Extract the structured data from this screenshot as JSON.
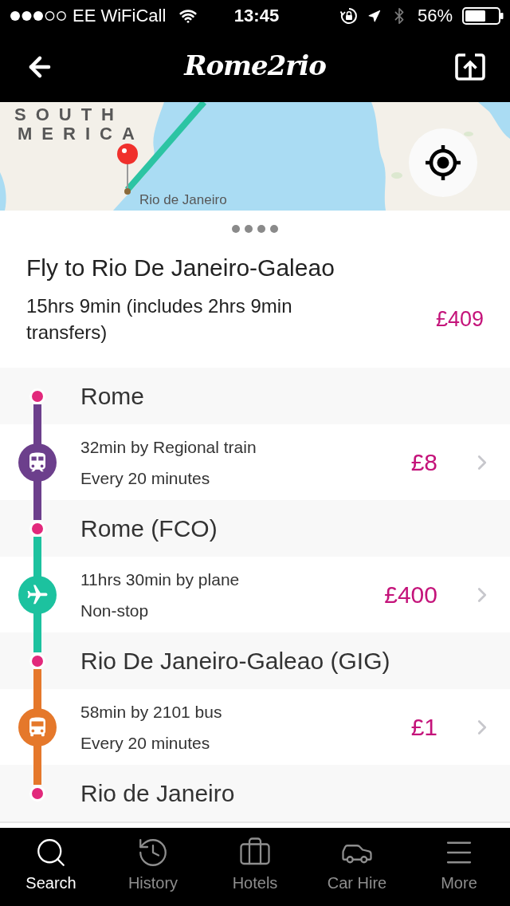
{
  "status_bar": {
    "carrier": "EE WiFiCall",
    "time": "13:45",
    "battery": "56%"
  },
  "header": {
    "logo": "Rome2rio"
  },
  "map": {
    "labels": [
      {
        "kind": "region",
        "text": "SOUTH"
      },
      {
        "kind": "region",
        "text": "MERICA"
      },
      {
        "kind": "city",
        "text": "Rio de Janeiro"
      }
    ]
  },
  "route": {
    "title": "Fly to Rio De Janeiro-Galeao",
    "summary": "15hrs 9min (includes 2hrs 9min transfers)",
    "price": "£409"
  },
  "itinerary": [
    {
      "kind": "stop",
      "name": "Rome"
    },
    {
      "kind": "train",
      "color": "#6c3f8c",
      "description": "32min by Regional train",
      "detail": "Every 20 minutes",
      "price": "£8"
    },
    {
      "kind": "stop",
      "name": "Rome (FCO)"
    },
    {
      "kind": "plane",
      "color": "#1cc29f",
      "description": "11hrs 30min by plane",
      "detail": "Non-stop",
      "price": "£400"
    },
    {
      "kind": "stop",
      "name": "Rio De Janeiro-Galeao (GIG)"
    },
    {
      "kind": "bus",
      "color": "#e5782b",
      "description": "58min by 2101 bus",
      "detail": "Every 20 minutes",
      "price": "£1"
    },
    {
      "kind": "stop",
      "name": "Rio de Janeiro"
    }
  ],
  "tabs": [
    {
      "label": "Search",
      "selected": true
    },
    {
      "label": "History",
      "selected": false
    },
    {
      "label": "Hotels",
      "selected": false
    },
    {
      "label": "Car Hire",
      "selected": false
    },
    {
      "label": "More",
      "selected": false
    }
  ]
}
